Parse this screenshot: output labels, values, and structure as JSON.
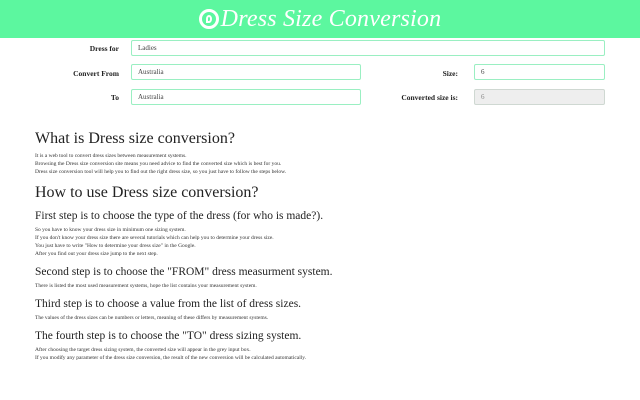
{
  "header": {
    "title": "Dress Size Conversion",
    "bg": "#5cf79f"
  },
  "form": {
    "dress_for_label": "Dress for",
    "dress_for_value": "Ladies",
    "convert_from_label": "Convert From",
    "convert_from_value": "Australia",
    "size_label": "Size:",
    "size_value": "6",
    "to_label": "To",
    "to_value": "Australia",
    "converted_label": "Converted size is:",
    "converted_value": "6"
  },
  "content": {
    "what_title": "What is Dress size conversion?",
    "what_lines": [
      "It is a web tool to convert dress sizes between measurement systems.",
      "Browsing the Dress size conversion site means you need advice to find the converted size which is best for you.",
      "Dress size conversion tool will help you to find out the right dress size, so you just have to follow the steps below."
    ],
    "how_title": "How to use Dress size conversion?",
    "step1_title": "First step is to choose the type of the dress (for who is made?).",
    "step1_lines": [
      "So you have to know your dress size in minimum one sizing system.",
      "If you don't know your dress size there are several tutorials which can help you to determine your dress size.",
      "You just have to write \"How to determine your dress size\" in the Google.",
      "After you find out your dress size jump to the next step."
    ],
    "step2_title": "Second step is to choose the \"FROM\" dress measurment system.",
    "step2_lines": [
      "There is listed the most used measurement systems, hope the list contains your measurement system."
    ],
    "step3_title": "Third step is to choose a value from the list of dress sizes.",
    "step3_lines": [
      "The values of the dress sizes can be numbers or letters, meaning of these differs by measurement systems."
    ],
    "step4_title": "The fourth step is to choose the \"TO\" dress sizing system.",
    "step4_lines": [
      "After choosing the target dress sizing system, the converted size will appear in the grey input box.",
      "If you modify any parameter of the dress size conversion, the result of the new conversion will be calculated automatically."
    ]
  }
}
